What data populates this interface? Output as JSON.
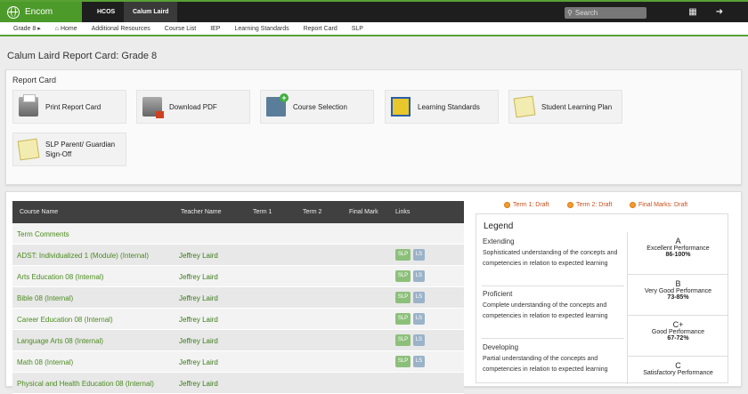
{
  "topbar": {
    "brand": "Encom",
    "tabs": [
      "HCOS",
      "Calum Laird"
    ],
    "search_placeholder": "Search",
    "icons": [
      "calendar-icon",
      "logout-icon"
    ]
  },
  "subnav": [
    "Grade 8 ▸",
    "⌂ Home",
    "Additional Resources",
    "Course List",
    "IEP",
    "Learning Standards",
    "Report Card",
    "SLP"
  ],
  "page_title": "Calum Laird Report Card: Grade 8",
  "report_card": {
    "title": "Report Card",
    "cards": [
      {
        "label": "Print Report Card",
        "icon": "printer-icon"
      },
      {
        "label": "Download PDF",
        "icon": "pdf-icon"
      },
      {
        "label": "Course Selection",
        "icon": "course-selection-icon"
      },
      {
        "label": "Learning Standards",
        "icon": "learning-standards-icon"
      },
      {
        "label": "Student Learning Plan",
        "icon": "learning-plan-icon"
      },
      {
        "label": "SLP Parent/ Guardian Sign-Off",
        "icon": "sign-off-icon"
      }
    ]
  },
  "table": {
    "headers": [
      "Course Name",
      "Teacher Name",
      "Term 1",
      "Term 2",
      "Final Mark",
      "Links"
    ],
    "rows": [
      {
        "course": "Term Comments",
        "teacher": "",
        "links": false
      },
      {
        "course": "ADST: Individualized 1 (Module) (Internal)",
        "teacher": "Jeffrey Laird",
        "links": true
      },
      {
        "course": "Arts Education 08 (Internal)",
        "teacher": "Jeffrey Laird",
        "links": true
      },
      {
        "course": "Bible 08 (Internal)",
        "teacher": "Jeffrey Laird",
        "links": true
      },
      {
        "course": "Career Education 08 (Internal)",
        "teacher": "Jeffrey Laird",
        "links": true
      },
      {
        "course": "Language Arts 08 (Internal)",
        "teacher": "Jeffrey Laird",
        "links": true
      },
      {
        "course": "Math 08 (Internal)",
        "teacher": "Jeffrey Laird",
        "links": true
      },
      {
        "course": "Physical and Health Education 08 (Internal)",
        "teacher": "Jeffrey Laird",
        "links": true
      }
    ],
    "slp_label": "SLP",
    "ls_label": "LS"
  },
  "status": [
    "Term 1: Draft",
    "Term 2: Draft",
    "Final Marks: Draft"
  ],
  "legend": {
    "title": "Legend",
    "levels": [
      {
        "name": "Extending",
        "desc": "Sophisticated understanding of the concepts and competencies in relation to expected learning"
      },
      {
        "name": "Proficient",
        "desc": "Complete understanding of the concepts and competencies in relation to expected learning"
      },
      {
        "name": "Developing",
        "desc": "Partial understanding of the concepts and competencies in relation to expected learning"
      }
    ],
    "grades": [
      {
        "grade": "A",
        "perf": "Excellent Performance",
        "range": "86-100%"
      },
      {
        "grade": "B",
        "perf": "Very Good Performance",
        "range": "73-85%"
      },
      {
        "grade": "C+",
        "perf": "Good Performance",
        "range": "67-72%"
      },
      {
        "grade": "C",
        "perf": "Satisfactory Performance",
        "range": ""
      }
    ]
  }
}
